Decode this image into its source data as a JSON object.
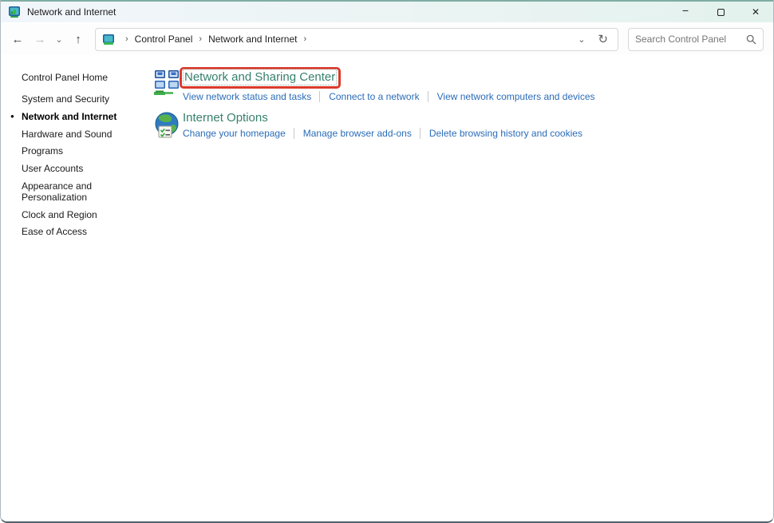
{
  "window": {
    "title": "Network and Internet",
    "controls": {
      "minimize": "−",
      "close": "✕"
    }
  },
  "toolbar": {
    "nav": {
      "back": "←",
      "forward": "→",
      "dropdown": "⌄",
      "up": "↑"
    },
    "breadcrumb": {
      "separator": "›",
      "items": [
        {
          "label": "Control Panel"
        },
        {
          "label": "Network and Internet"
        }
      ]
    },
    "dropdown_glyph": "⌄",
    "refresh_glyph": "↻",
    "search": {
      "placeholder": "Search Control Panel"
    }
  },
  "sidebar": {
    "home": "Control Panel Home",
    "bullet": "●",
    "items": [
      {
        "label": "System and Security",
        "active": false
      },
      {
        "label": "Network and Internet",
        "active": true
      },
      {
        "label": "Hardware and Sound",
        "active": false
      },
      {
        "label": "Programs",
        "active": false
      },
      {
        "label": "User Accounts",
        "active": false
      },
      {
        "label": "Appearance and Personalization",
        "active": false
      },
      {
        "label": "Clock and Region",
        "active": false
      },
      {
        "label": "Ease of Access",
        "active": false
      }
    ]
  },
  "main": {
    "groups": [
      {
        "title": "Network and Sharing Center",
        "highlighted": true,
        "links": [
          {
            "label": "View network status and tasks"
          },
          {
            "label": "Connect to a network"
          },
          {
            "label": "View network computers and devices"
          }
        ]
      },
      {
        "title": "Internet Options",
        "highlighted": false,
        "links": [
          {
            "label": "Change your homepage"
          },
          {
            "label": "Manage browser add-ons"
          },
          {
            "label": "Delete browsing history and cookies"
          }
        ]
      }
    ]
  },
  "colors": {
    "heading_teal": "#37806c",
    "link_blue": "#2b6cb8",
    "annotation_red": "#dc3a2c",
    "titlebar_tint": "#e3f2ed"
  }
}
